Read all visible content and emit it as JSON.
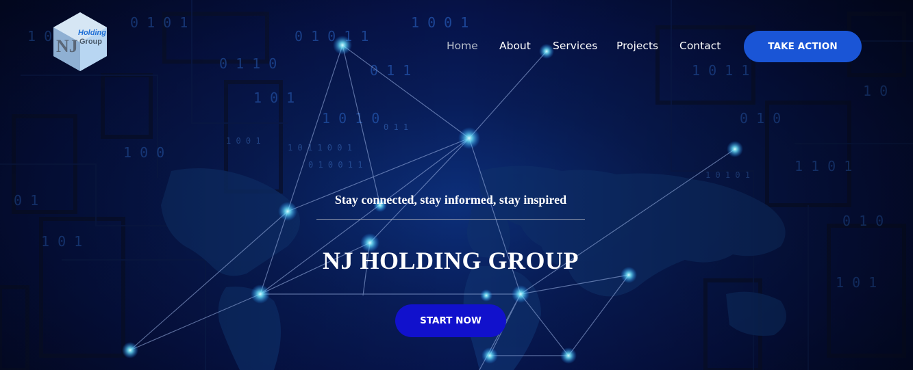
{
  "brand": {
    "logo_word1": "Holding",
    "logo_word2": "Group",
    "logo_mark": "NJ"
  },
  "nav": {
    "items": [
      {
        "label": "Home",
        "active": true
      },
      {
        "label": "About",
        "active": false
      },
      {
        "label": "Services",
        "active": false
      },
      {
        "label": "Projects",
        "active": false
      },
      {
        "label": "Contact",
        "active": false
      }
    ],
    "cta_label": "TAKE ACTION"
  },
  "hero": {
    "tagline": "Stay connected, stay informed, stay inspired",
    "title": "NJ HOLDING GROUP",
    "cta_label": "START NOW",
    "background": "network-world-map-binary"
  },
  "colors": {
    "background_dark": "#030a2c",
    "background_mid": "#0c2f7a",
    "cta_top": "#1a55d6",
    "cta_main": "#1111cc",
    "nav_active": "#b9c0cc",
    "text": "#ffffff"
  }
}
